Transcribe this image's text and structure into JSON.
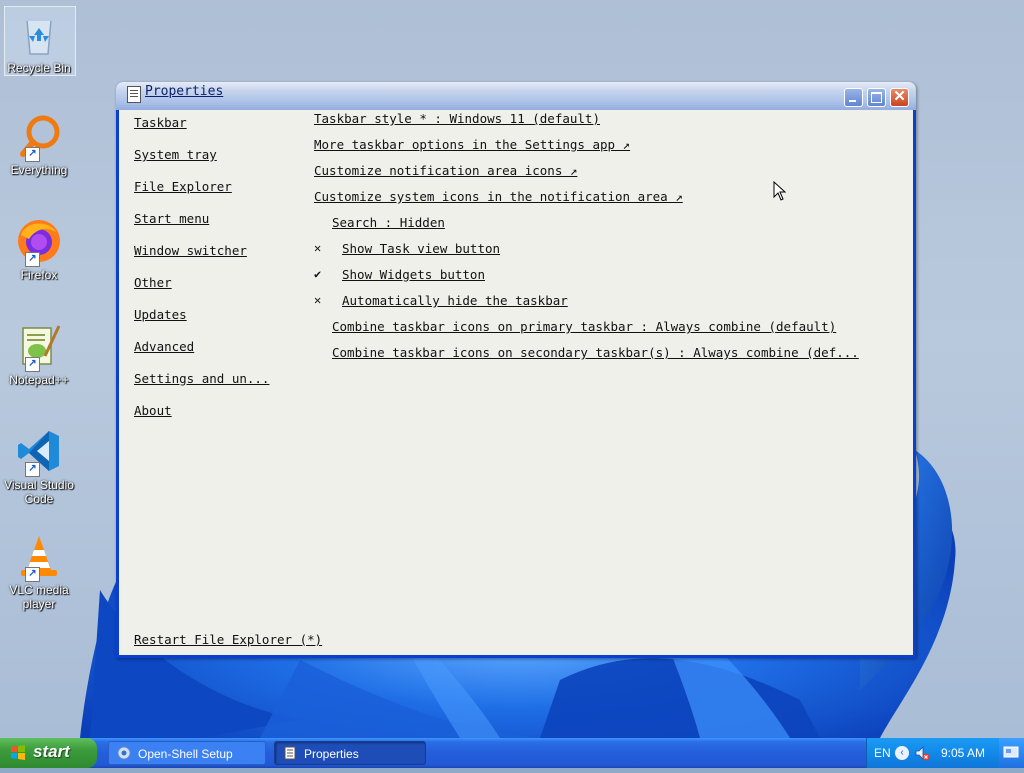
{
  "desktop": {
    "icons": [
      {
        "label": "Recycle Bin",
        "icon": "recycle-bin-icon",
        "shortcut": false
      },
      {
        "label": "Everything",
        "icon": "everything-search-icon",
        "shortcut": true
      },
      {
        "label": "Firefox",
        "icon": "firefox-icon",
        "shortcut": true
      },
      {
        "label": "Notepad++",
        "icon": "notepad-plus-plus-icon",
        "shortcut": true
      },
      {
        "label": "Visual Studio Code",
        "icon": "vscode-icon",
        "shortcut": true
      },
      {
        "label": "VLC media player",
        "icon": "vlc-icon",
        "shortcut": true
      }
    ]
  },
  "window": {
    "title": "Properties",
    "nav": [
      "Taskbar",
      "System tray",
      "File Explorer",
      "Start menu",
      "Window switcher",
      "Other",
      "Updates",
      "Advanced",
      "Settings and un...",
      "About"
    ],
    "options": [
      {
        "label": "Taskbar style * : Windows 11 (default)",
        "mark": ""
      },
      {
        "label": "More taskbar options in the Settings app ↗",
        "mark": ""
      },
      {
        "label": "Customize notification area icons ↗",
        "mark": ""
      },
      {
        "label": "Customize system icons in the notification area ↗",
        "mark": ""
      },
      {
        "label": "Search : Hidden",
        "mark": ""
      },
      {
        "label": "Show Task view button",
        "mark": "✕"
      },
      {
        "label": "Show Widgets button",
        "mark": "✔"
      },
      {
        "label": "Automatically hide the taskbar",
        "mark": "✕"
      },
      {
        "label": "Combine taskbar icons on primary taskbar : Always combine (default)",
        "mark": ""
      },
      {
        "label": "Combine taskbar icons on secondary taskbar(s) : Always combine (def...",
        "mark": ""
      }
    ],
    "restart": "Restart File Explorer (*)"
  },
  "taskbar": {
    "start_label": "start",
    "tasks": [
      {
        "label": "Open-Shell Setup",
        "icon": "setup-icon",
        "active": false
      },
      {
        "label": "Properties",
        "icon": "properties-icon",
        "active": true
      }
    ],
    "tray": {
      "language": "EN",
      "time": "9:05 AM"
    }
  },
  "colors": {
    "window_frame": "#0a3fd0",
    "client_bg": "#f0f0eb",
    "taskbar": "#245edb",
    "start_green": "#3c9c3c"
  }
}
